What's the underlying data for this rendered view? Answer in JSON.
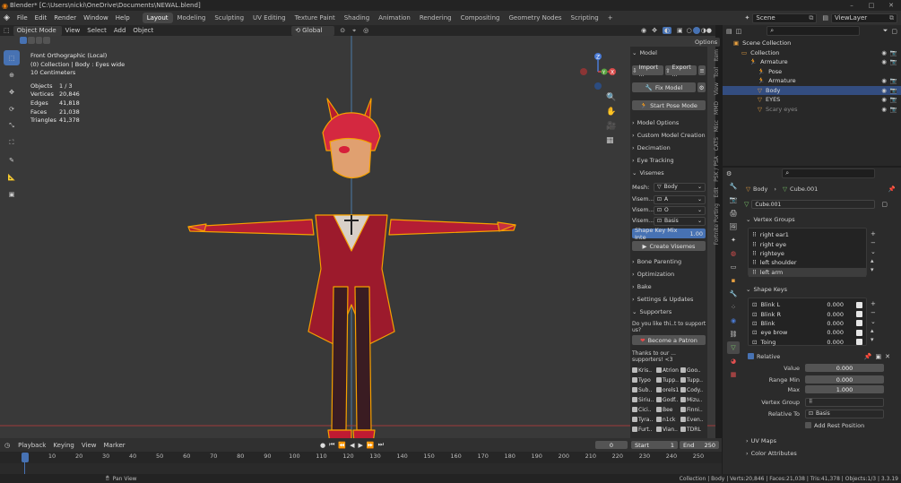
{
  "window": {
    "title": "Blender* [C:\\Users\\nicki\\OneDrive\\Documents\\NEWAL.blend]",
    "minimize": "–",
    "maximize": "□",
    "close": "✕"
  },
  "menu": {
    "items": [
      "File",
      "Edit",
      "Render",
      "Window",
      "Help"
    ]
  },
  "workspaces": {
    "tabs": [
      "Layout",
      "Modeling",
      "Sculpting",
      "UV Editing",
      "Texture Paint",
      "Shading",
      "Animation",
      "Rendering",
      "Compositing",
      "Geometry Nodes",
      "Scripting"
    ],
    "active": "Layout",
    "add": "+"
  },
  "scene": {
    "name": "Scene",
    "view_layer": "ViewLayer"
  },
  "viewport_header": {
    "mode": "Object Mode",
    "view": "View",
    "select": "Select",
    "add": "Add",
    "object": "Object",
    "transform": "Global",
    "options": "Options"
  },
  "overlay_text": {
    "view_name": "Front Orthographic (Local)",
    "collection_line": "(0) Collection | Body : Eyes wide",
    "scale": "10 Centimeters"
  },
  "stats": [
    {
      "label": "Objects",
      "value": "1 / 3"
    },
    {
      "label": "Vertices",
      "value": "20,846"
    },
    {
      "label": "Edges",
      "value": "41,818"
    },
    {
      "label": "Faces",
      "value": "21,038"
    },
    {
      "label": "Triangles",
      "value": "41,378"
    }
  ],
  "gizmo": {
    "z": "Z",
    "x": "X",
    "y": "Y"
  },
  "npanel": {
    "tabs": [
      "Item",
      "Tool",
      "View",
      "MMD",
      "Misc",
      "CATS",
      "PSK / PSA",
      "Edit",
      "Fortnite Porting"
    ],
    "model_header": "Model",
    "import": "Import ...",
    "export": "Export ...",
    "fix_model": "Fix Model",
    "start_pose": "Start Pose Mode",
    "sections": [
      "Model Options",
      "Custom Model Creation",
      "Decimation",
      "Eye Tracking"
    ],
    "visemes_header": "Visemes",
    "mesh_label": "Mesh:",
    "mesh_value": "Body",
    "viseme_rows": [
      {
        "label": "Visem...",
        "value": "A"
      },
      {
        "label": "Visem...",
        "value": "O"
      },
      {
        "label": "Visem...",
        "value": "Basis"
      }
    ],
    "mix_label": "Shape Key Mix Inte",
    "mix_value": "1.00",
    "create_visemes": "Create Visemes",
    "sections2": [
      "Bone Parenting",
      "Optimization",
      "Bake",
      "Settings & Updates"
    ],
    "supporters_header": "Supporters",
    "patron_q": "Do you like thi..t to support us?",
    "patron_btn": "Become a Patron",
    "thanks": "Thanks to our ... supporters! <3",
    "supporters": [
      "Kris..",
      "Atrion",
      "Goo..",
      "Typo",
      "Tupp..",
      "Tupp..",
      "Sub..",
      "orels1",
      "Cody..",
      "Siriu..",
      "Godf..",
      "Mizu..",
      "Cici..",
      "Bee",
      "Finni..",
      "Tyra..",
      "n1ck",
      "Even..",
      "Furt..",
      "Vian..",
      "TDRL"
    ]
  },
  "timeline": {
    "playback": "Playback",
    "keying": "Keying",
    "view": "View",
    "marker": "Marker",
    "current": "0",
    "start_label": "Start",
    "start": "1",
    "end_label": "End",
    "end": "250",
    "ticks": [
      "0",
      "10",
      "20",
      "30",
      "40",
      "50",
      "60",
      "70",
      "80",
      "90",
      "100",
      "110",
      "120",
      "130",
      "140",
      "150",
      "160",
      "170",
      "180",
      "190",
      "200",
      "210",
      "220",
      "230",
      "240",
      "250"
    ]
  },
  "statusbar": {
    "hint": "Pan View",
    "info": "Collection | Body | Verts:20,846 | Faces:21,038 | Tris:41,378 | Objects:1/3 | 3.3.19"
  },
  "outliner": {
    "rows": [
      {
        "label": "Scene Collection",
        "indent": 0,
        "selected": false
      },
      {
        "label": "Collection",
        "indent": 1,
        "selected": false
      },
      {
        "label": "Armature",
        "indent": 2,
        "selected": false
      },
      {
        "label": "Pose",
        "indent": 3,
        "selected": false
      },
      {
        "label": "Armature",
        "indent": 3,
        "selected": false
      },
      {
        "label": "Body",
        "indent": 3,
        "selected": true
      },
      {
        "label": "EYES",
        "indent": 3,
        "selected": false
      },
      {
        "label": "Scary eyes",
        "indent": 3,
        "selected": false
      }
    ]
  },
  "properties": {
    "breadcrumb_object": "Body",
    "breadcrumb_mesh": "Cube.001",
    "mesh_name": "Cube.001",
    "vertex_groups_header": "Vertex Groups",
    "vertex_groups": [
      "right ear1",
      "right eye",
      "righteye",
      "left shoulder",
      "left arm"
    ],
    "shape_keys_header": "Shape Keys",
    "shape_keys": [
      {
        "name": "Blink L",
        "value": "0.000"
      },
      {
        "name": "Blink R",
        "value": "0.000"
      },
      {
        "name": "Blink",
        "value": "0.000"
      },
      {
        "name": "eye brow",
        "value": "0.000"
      },
      {
        "name": "Toing",
        "value": "0.000"
      }
    ],
    "relative_label": "Relative",
    "value_label": "Value",
    "value": "0.000",
    "range_min_label": "Range Min",
    "range_min": "0.000",
    "max_label": "Max",
    "max": "1.000",
    "vertex_group_label": "Vertex Group",
    "relative_to_label": "Relative To",
    "relative_to": "Basis",
    "add_rest": "Add Rest Position",
    "uv_maps": "UV Maps",
    "color_attributes": "Color Attributes"
  },
  "colors": {
    "accent": "#4772b3",
    "outline": "#f5a000",
    "character_red": "#c8203a"
  }
}
